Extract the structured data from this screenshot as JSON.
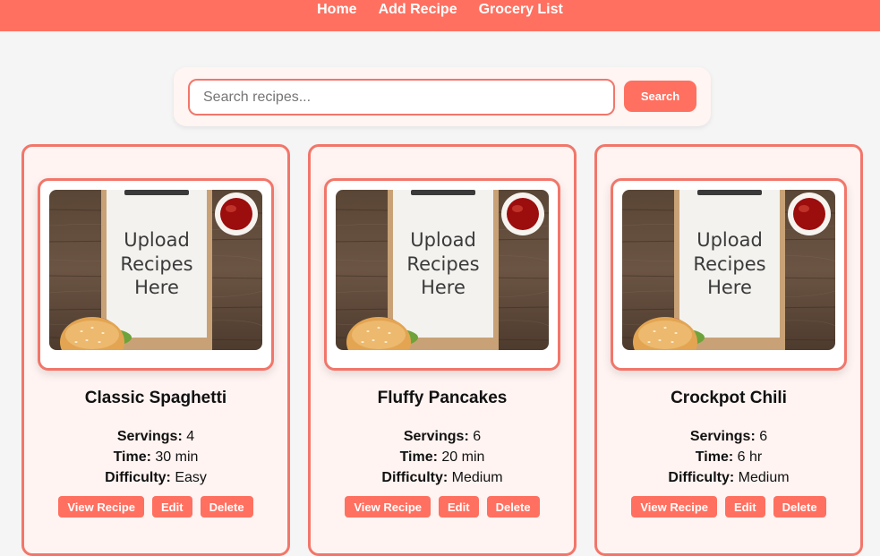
{
  "nav": {
    "items": [
      {
        "label": "Home"
      },
      {
        "label": "Add Recipe"
      },
      {
        "label": "Grocery List"
      }
    ]
  },
  "search": {
    "placeholder": "Search recipes...",
    "value": "",
    "button_label": "Search"
  },
  "labels": {
    "servings": "Servings:",
    "time": "Time:",
    "difficulty": "Difficulty:",
    "view": "View Recipe",
    "edit": "Edit",
    "delete": "Delete",
    "image_text": [
      "Upload",
      "Recipes",
      "Here"
    ]
  },
  "recipes": [
    {
      "title": "Classic Spaghetti",
      "servings": "4",
      "time": "30 min",
      "difficulty": "Easy"
    },
    {
      "title": "Fluffy Pancakes",
      "servings": "6",
      "time": "20 min",
      "difficulty": "Medium"
    },
    {
      "title": "Crockpot Chili",
      "servings": "6",
      "time": "6 hr",
      "difficulty": "Medium"
    }
  ],
  "colors": {
    "accent": "#ff7060",
    "border": "#f2766a",
    "card_bg": "#fff4f2",
    "page_bg": "#f5f5f5"
  }
}
